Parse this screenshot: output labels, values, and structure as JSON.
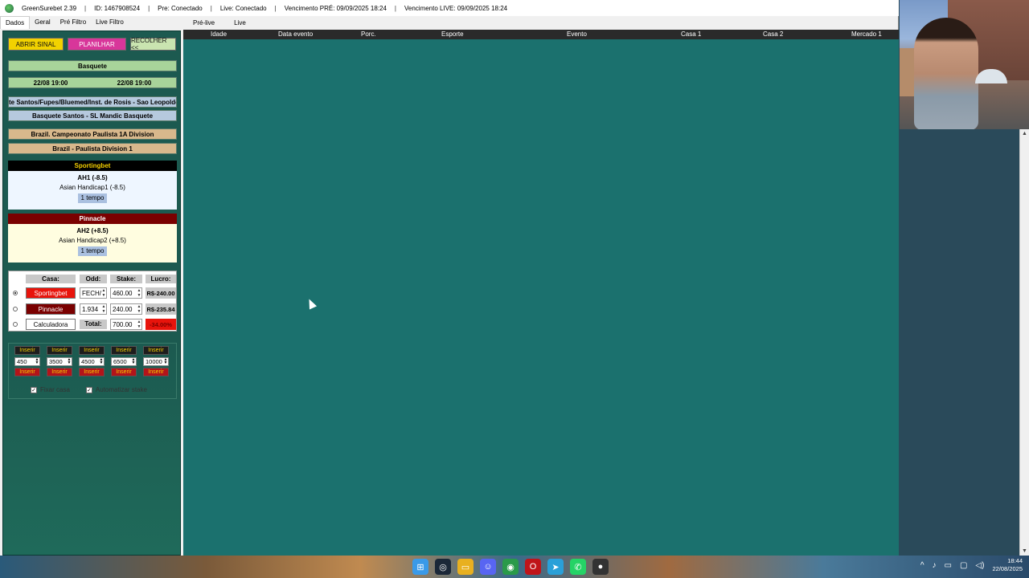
{
  "titlebar": {
    "app": "GreenSurebet 2.39",
    "id": "ID: 1467908524",
    "pre": "Pre: Conectado",
    "live": "Live: Conectado",
    "venc_pre": "Vencimento PRÉ: 09/09/2025 18:24",
    "venc_live": "Vencimento LIVE: 09/09/2025 18:24",
    "sep": "|"
  },
  "menu": [
    "Dados",
    "Geral",
    "Pré Filtro",
    "Live Filtro"
  ],
  "tabs": [
    "Pré-live",
    "Live"
  ],
  "buttons": {
    "abrir": "ABRIR SINAL",
    "planilhar": "PLANILHAR",
    "recolher": "RECOLHER <<"
  },
  "event": {
    "sport": "Basquete",
    "date1": "22/08 19:00",
    "date2": "22/08 19:00",
    "teams_full": "te Santos/Fupes/Bluemed/Inst. de Rosis - Sao Leopoldo",
    "teams": "Basquete Santos - SL Mandic Basquete",
    "league1": "Brazil. Campeonato Paulista 1A Division",
    "league2": "Brazil - Paulista Division 1"
  },
  "house1": {
    "name": "Sportingbet",
    "market": "AH1 (-8.5)",
    "desc": "Asian Handicap1 (-8.5)",
    "period": "1 tempo"
  },
  "house2": {
    "name": "Pinnacle",
    "market": "AH2 (+8.5)",
    "desc": "Asian Handicap2 (+8.5)",
    "period": "1 tempo"
  },
  "calc": {
    "headers": {
      "casa": "Casa:",
      "odd": "Odd:",
      "stake": "Stake:",
      "lucro": "Lucro:"
    },
    "rows": [
      {
        "casa": "Sportingbet",
        "odd": "FECH/",
        "stake": "460.00",
        "lucro": "R$-240.00"
      },
      {
        "casa": "Pinnacle",
        "odd": "1.934",
        "stake": "240.00",
        "lucro": "R$-235.84"
      }
    ],
    "calc_label": "Calculadora",
    "total_label": "Total:",
    "total": "700.00",
    "pct": "-34.00%",
    "colors": {
      "sportingbet": "#e8140c",
      "pinnacle": "#7a0000",
      "loss": "#e8140c"
    }
  },
  "inserir": {
    "label": "Inserir",
    "values": [
      "450",
      "3500",
      "4500",
      "6500",
      "10000"
    ]
  },
  "checks": {
    "fixar": "Fixar casa",
    "auto": "Automatizar stake"
  },
  "grid": {
    "columns": [
      "Idade",
      "Data evento",
      "Porc.",
      "Esporte",
      "Evento",
      "Casa 1",
      "Casa 2",
      "Mercado 1"
    ]
  },
  "taskbar": {
    "time": "18:44",
    "date": "22/08/2025"
  }
}
